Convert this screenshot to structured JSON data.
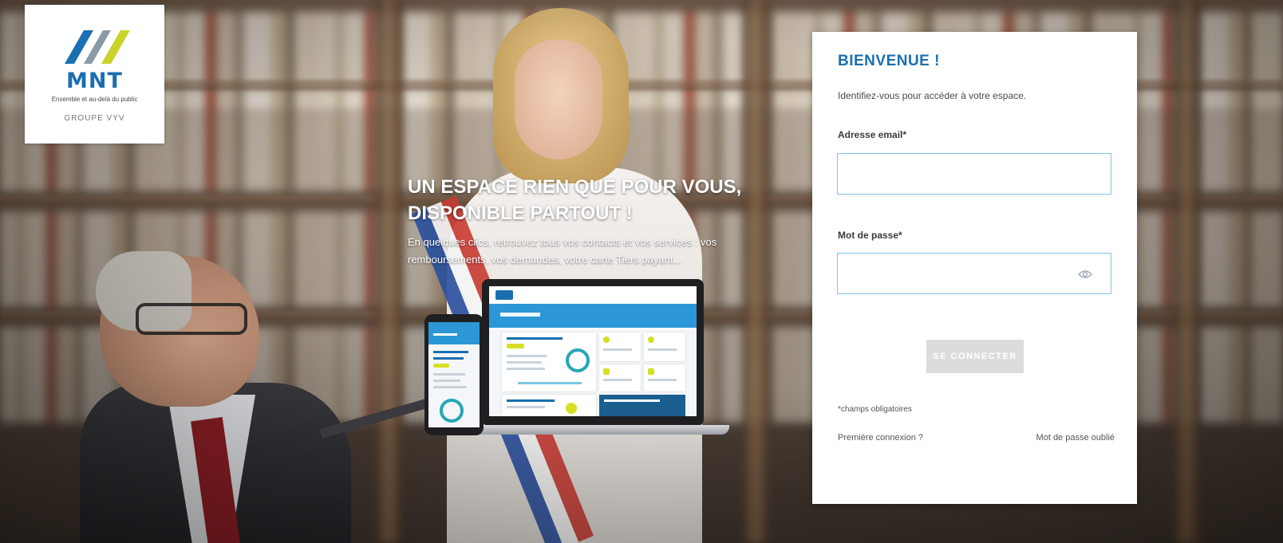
{
  "logo": {
    "brand": "MNT",
    "tagline": "Ensemble et au-delà du public",
    "group": "GROUPE VYV",
    "colors": {
      "blue": "#1a6fb0",
      "gray": "#8a9aa5",
      "lime": "#c9d32a"
    }
  },
  "hero": {
    "title": "UN ESPACE RIEN QUE POUR VOUS, DISPONIBLE PARTOUT !",
    "subtitle": "En quelques clics, retrouvez tous vos contacts et vos services : vos remboursements, vos demandes, votre carte Tiers payant..."
  },
  "login": {
    "title": "BIENVENUE !",
    "intro": "Identifiez-vous pour accéder à votre espace.",
    "email_label": "Adresse email*",
    "email_value": "",
    "email_placeholder": "",
    "password_label": "Mot de passe*",
    "password_value": "",
    "password_placeholder": "",
    "show_password_icon": "eye-icon",
    "submit_label": "SE CONNECTER",
    "required_note": "*champs obligatoires",
    "first_login_link": "Première connexion ?",
    "forgot_password_link": "Mot de passe oublié"
  },
  "colors": {
    "accent": "#1a6fb0",
    "input_border": "#7fc3e5",
    "button_disabled": "#dcdcdc"
  }
}
